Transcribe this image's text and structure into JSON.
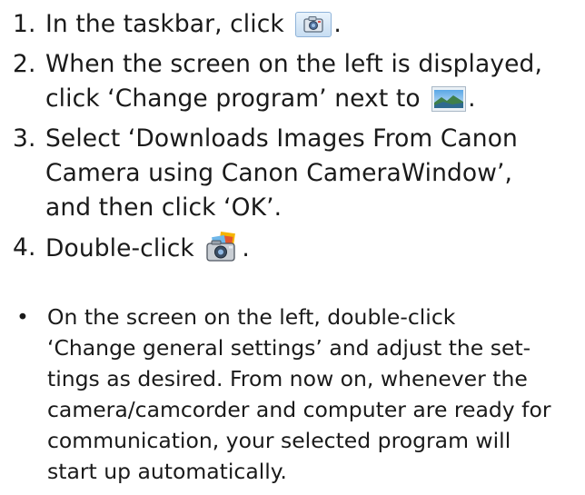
{
  "steps": [
    {
      "number": "1.",
      "text_before": "In the taskbar, click",
      "text_after": ".",
      "icon": "camera-taskbar-icon"
    },
    {
      "number": "2.",
      "line1": "When the screen on the left is displayed,",
      "line2_before": "click ‘Change program’ next to",
      "line2_after": ".",
      "icon": "landscape-photo-icon"
    },
    {
      "number": "3.",
      "line1": "Select ‘Downloads Images From Canon",
      "line2": "Camera using Canon CameraWindow’,",
      "line3": "and then click ‘OK’."
    },
    {
      "number": "4.",
      "text_before": "Double-click",
      "text_after": ".",
      "icon": "camerawindow-app-icon"
    }
  ],
  "note": {
    "bullet": "•",
    "lines": [
      "On the screen on the left, double-click",
      "‘Change general settings’ and adjust the set-",
      "tings as desired. From now on, whenever the",
      "camera/camcorder and computer are ready for",
      "communication, your selected program will",
      "start up automatically."
    ]
  }
}
